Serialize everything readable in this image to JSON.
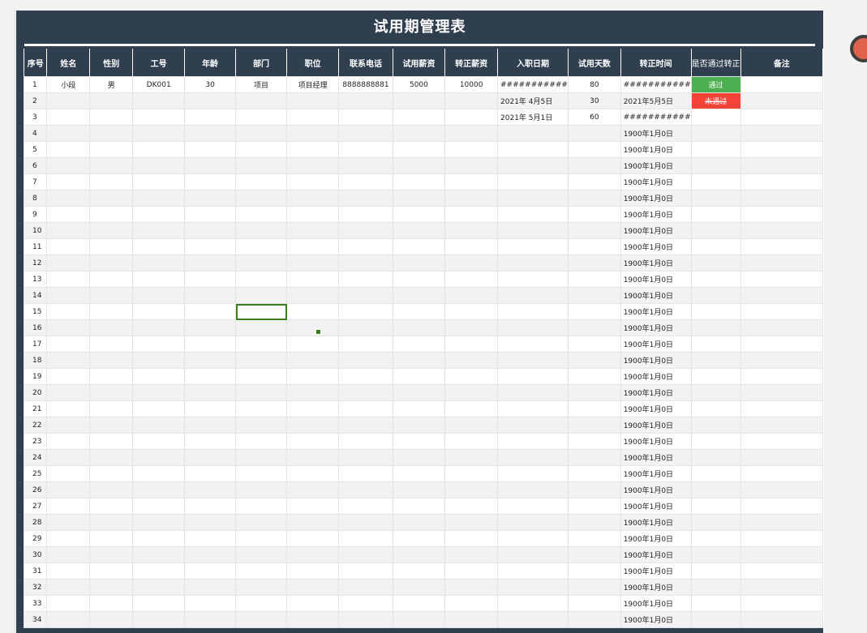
{
  "title": "试用期管理表",
  "columns": [
    "序号",
    "姓名",
    "性别",
    "工号",
    "年龄",
    "部门",
    "职位",
    "联系电话",
    "试用薪资",
    "转正薪资",
    "入职日期",
    "试用天数",
    "转正时间",
    "是否通过转正",
    "备注"
  ],
  "status_colors": {
    "pass": "#4caf50",
    "fail": "#f44336"
  },
  "rows": [
    [
      "1",
      "小段",
      "男",
      "DK001",
      "30",
      "项目",
      "项目经理",
      "8888888881",
      "5000",
      "10000",
      "###########",
      "80",
      "###########",
      "通过",
      ""
    ],
    [
      "2",
      "",
      "",
      "",
      "",
      "",
      "",
      "",
      "",
      "",
      "2021年 4月5日",
      "30",
      "2021年5月5日",
      "未通过",
      ""
    ],
    [
      "3",
      "",
      "",
      "",
      "",
      "",
      "",
      "",
      "",
      "",
      "2021年 5月1日",
      "60",
      "###########",
      "",
      ""
    ],
    [
      "4",
      "",
      "",
      "",
      "",
      "",
      "",
      "",
      "",
      "",
      "",
      "",
      "1900年1月0日",
      "",
      ""
    ],
    [
      "5",
      "",
      "",
      "",
      "",
      "",
      "",
      "",
      "",
      "",
      "",
      "",
      "1900年1月0日",
      "",
      ""
    ],
    [
      "6",
      "",
      "",
      "",
      "",
      "",
      "",
      "",
      "",
      "",
      "",
      "",
      "1900年1月0日",
      "",
      ""
    ],
    [
      "7",
      "",
      "",
      "",
      "",
      "",
      "",
      "",
      "",
      "",
      "",
      "",
      "1900年1月0日",
      "",
      ""
    ],
    [
      "8",
      "",
      "",
      "",
      "",
      "",
      "",
      "",
      "",
      "",
      "",
      "",
      "1900年1月0日",
      "",
      ""
    ],
    [
      "9",
      "",
      "",
      "",
      "",
      "",
      "",
      "",
      "",
      "",
      "",
      "",
      "1900年1月0日",
      "",
      ""
    ],
    [
      "10",
      "",
      "",
      "",
      "",
      "",
      "",
      "",
      "",
      "",
      "",
      "",
      "1900年1月0日",
      "",
      ""
    ],
    [
      "11",
      "",
      "",
      "",
      "",
      "",
      "",
      "",
      "",
      "",
      "",
      "",
      "1900年1月0日",
      "",
      ""
    ],
    [
      "12",
      "",
      "",
      "",
      "",
      "",
      "",
      "",
      "",
      "",
      "",
      "",
      "1900年1月0日",
      "",
      ""
    ],
    [
      "13",
      "",
      "",
      "",
      "",
      "",
      "",
      "",
      "",
      "",
      "",
      "",
      "1900年1月0日",
      "",
      ""
    ],
    [
      "14",
      "",
      "",
      "",
      "",
      "",
      "",
      "",
      "",
      "",
      "",
      "",
      "1900年1月0日",
      "",
      ""
    ],
    [
      "15",
      "",
      "",
      "",
      "",
      "",
      "",
      "",
      "",
      "",
      "",
      "",
      "1900年1月0日",
      "",
      ""
    ],
    [
      "16",
      "",
      "",
      "",
      "",
      "",
      "",
      "",
      "",
      "",
      "",
      "",
      "1900年1月0日",
      "",
      ""
    ],
    [
      "17",
      "",
      "",
      "",
      "",
      "",
      "",
      "",
      "",
      "",
      "",
      "",
      "1900年1月0日",
      "",
      ""
    ],
    [
      "18",
      "",
      "",
      "",
      "",
      "",
      "",
      "",
      "",
      "",
      "",
      "",
      "1900年1月0日",
      "",
      ""
    ],
    [
      "19",
      "",
      "",
      "",
      "",
      "",
      "",
      "",
      "",
      "",
      "",
      "",
      "1900年1月0日",
      "",
      ""
    ],
    [
      "20",
      "",
      "",
      "",
      "",
      "",
      "",
      "",
      "",
      "",
      "",
      "",
      "1900年1月0日",
      "",
      ""
    ],
    [
      "21",
      "",
      "",
      "",
      "",
      "",
      "",
      "",
      "",
      "",
      "",
      "",
      "1900年1月0日",
      "",
      ""
    ],
    [
      "22",
      "",
      "",
      "",
      "",
      "",
      "",
      "",
      "",
      "",
      "",
      "",
      "1900年1月0日",
      "",
      ""
    ],
    [
      "23",
      "",
      "",
      "",
      "",
      "",
      "",
      "",
      "",
      "",
      "",
      "",
      "1900年1月0日",
      "",
      ""
    ],
    [
      "24",
      "",
      "",
      "",
      "",
      "",
      "",
      "",
      "",
      "",
      "",
      "",
      "1900年1月0日",
      "",
      ""
    ],
    [
      "25",
      "",
      "",
      "",
      "",
      "",
      "",
      "",
      "",
      "",
      "",
      "",
      "1900年1月0日",
      "",
      ""
    ],
    [
      "26",
      "",
      "",
      "",
      "",
      "",
      "",
      "",
      "",
      "",
      "",
      "",
      "1900年1月0日",
      "",
      ""
    ],
    [
      "27",
      "",
      "",
      "",
      "",
      "",
      "",
      "",
      "",
      "",
      "",
      "",
      "1900年1月0日",
      "",
      ""
    ],
    [
      "28",
      "",
      "",
      "",
      "",
      "",
      "",
      "",
      "",
      "",
      "",
      "",
      "1900年1月0日",
      "",
      ""
    ],
    [
      "29",
      "",
      "",
      "",
      "",
      "",
      "",
      "",
      "",
      "",
      "",
      "",
      "1900年1月0日",
      "",
      ""
    ],
    [
      "30",
      "",
      "",
      "",
      "",
      "",
      "",
      "",
      "",
      "",
      "",
      "",
      "1900年1月0日",
      "",
      ""
    ],
    [
      "31",
      "",
      "",
      "",
      "",
      "",
      "",
      "",
      "",
      "",
      "",
      "",
      "1900年1月0日",
      "",
      ""
    ],
    [
      "32",
      "",
      "",
      "",
      "",
      "",
      "",
      "",
      "",
      "",
      "",
      "",
      "1900年1月0日",
      "",
      ""
    ],
    [
      "33",
      "",
      "",
      "",
      "",
      "",
      "",
      "",
      "",
      "",
      "",
      "",
      "1900年1月0日",
      "",
      ""
    ],
    [
      "34",
      "",
      "",
      "",
      "",
      "",
      "",
      "",
      "",
      "",
      "",
      "",
      "1900年1月0日",
      "",
      ""
    ]
  ]
}
